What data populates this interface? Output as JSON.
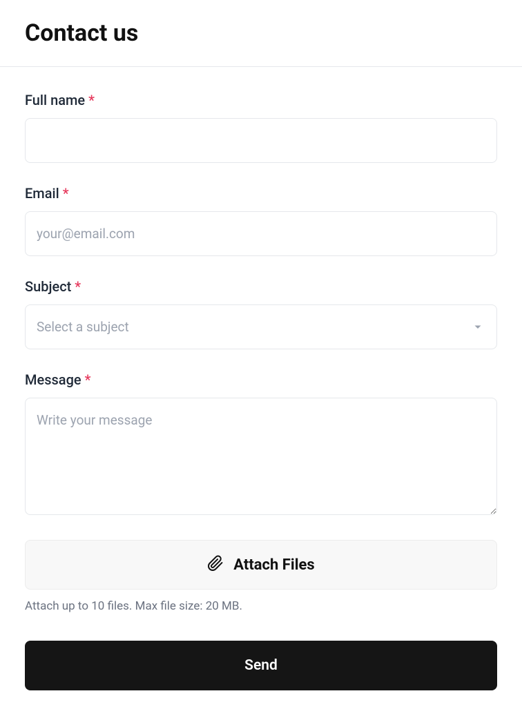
{
  "page_title": "Contact us",
  "required_marker": "*",
  "fields": {
    "full_name": {
      "label": "Full name",
      "value": ""
    },
    "email": {
      "label": "Email",
      "placeholder": "your@email.com",
      "value": ""
    },
    "subject": {
      "label": "Subject",
      "placeholder": "Select a subject",
      "value": ""
    },
    "message": {
      "label": "Message",
      "placeholder": "Write your message",
      "value": ""
    }
  },
  "attach": {
    "button_label": "Attach Files",
    "hint": "Attach up to 10 files. Max file size: 20 MB."
  },
  "submit_label": "Send"
}
